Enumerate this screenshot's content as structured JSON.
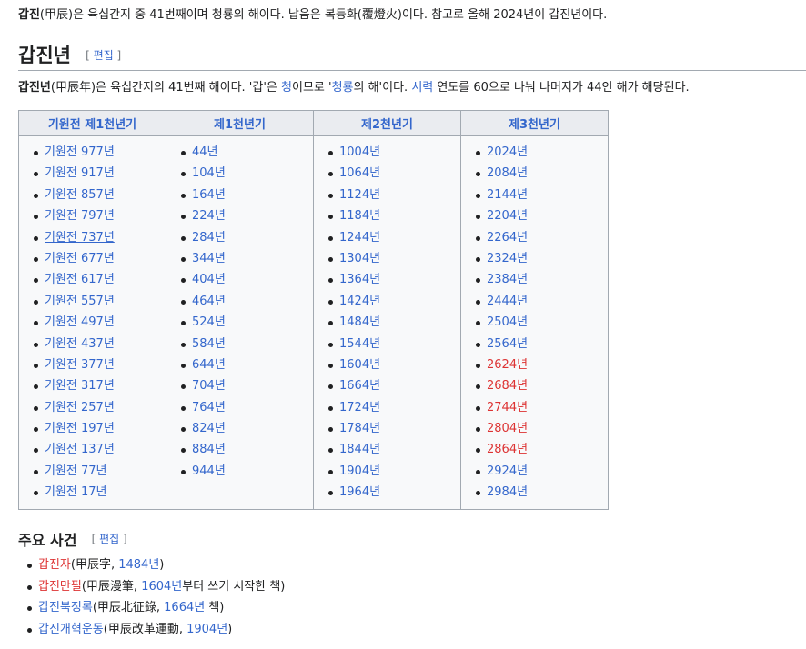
{
  "lead": {
    "term": "갑진",
    "hanja": "(甲辰)",
    "text1": "은 육십간지 중 41번째이며 청룡의 해이다. 납음은 복등화(覆燈火)이다. 참고로 올해 2024년이 갑진년이다."
  },
  "section": {
    "title": "갑진년",
    "edit_open": "[",
    "edit_label": "편집",
    "edit_close": "]"
  },
  "intro": {
    "term": "갑진년",
    "hanja": "(甲辰年)",
    "p1": "은 육십간지의 41번째 해이다. '갑'은 ",
    "link_cheong": "청",
    "p2": "이므로 '",
    "link_cheongryong": "청룡",
    "p3": "의 해'이다. ",
    "link_seoryeok": "서력",
    "p4": " 연도를 60으로 나눠 나머지가 44인 해가 해당된다."
  },
  "table": {
    "headers": [
      "기원전 제1천년기",
      "제1천년기",
      "제2천년기",
      "제3천년기"
    ],
    "col0": [
      "기원전 977년",
      "기원전 917년",
      "기원전 857년",
      "기원전 797년",
      "기원전 737년",
      "기원전 677년",
      "기원전 617년",
      "기원전 557년",
      "기원전 497년",
      "기원전 437년",
      "기원전 377년",
      "기원전 317년",
      "기원전 257년",
      "기원전 197년",
      "기원전 137년",
      "기원전 77년",
      "기원전 17년"
    ],
    "col1": [
      "44년",
      "104년",
      "164년",
      "224년",
      "284년",
      "344년",
      "404년",
      "464년",
      "524년",
      "584년",
      "644년",
      "704년",
      "764년",
      "824년",
      "884년",
      "944년"
    ],
    "col2": [
      "1004년",
      "1064년",
      "1124년",
      "1184년",
      "1244년",
      "1304년",
      "1364년",
      "1424년",
      "1484년",
      "1544년",
      "1604년",
      "1664년",
      "1724년",
      "1784년",
      "1844년",
      "1904년",
      "1964년"
    ],
    "col3": [
      "2024년",
      "2084년",
      "2144년",
      "2204년",
      "2264년",
      "2324년",
      "2384년",
      "2444년",
      "2504년",
      "2564년",
      "2624년",
      "2684년",
      "2744년",
      "2804년",
      "2864년",
      "2924년",
      "2984년"
    ],
    "col3_red_indexes": [
      10,
      11,
      12,
      13,
      14
    ]
  },
  "events": {
    "title": "주요 사건",
    "edit_label": "편집",
    "items": [
      {
        "link": "갑진자",
        "link_red": true,
        "p1": "(甲辰字, ",
        "link2": "1484년",
        "p2": ")"
      },
      {
        "link": "갑진만필",
        "link_red": true,
        "p1": "(甲辰漫筆, ",
        "link2": "1604년",
        "p2": "부터 쓰기 시작한 책)"
      },
      {
        "link": "갑진북정록",
        "link_red": false,
        "p1": "(甲辰北征錄, ",
        "link2": "1664년",
        "p2": " 책)"
      },
      {
        "link": "갑진개혁운동",
        "link_red": false,
        "p1": "(甲辰改革運動, ",
        "link2": "1904년",
        "p2": ")"
      }
    ]
  },
  "colors": {
    "link": "#3366cc",
    "redlink": "#dd3333",
    "text": "#202122",
    "border": "#a2a9b1",
    "header_bg": "#eaecf0",
    "table_bg": "#f8f9fa"
  }
}
